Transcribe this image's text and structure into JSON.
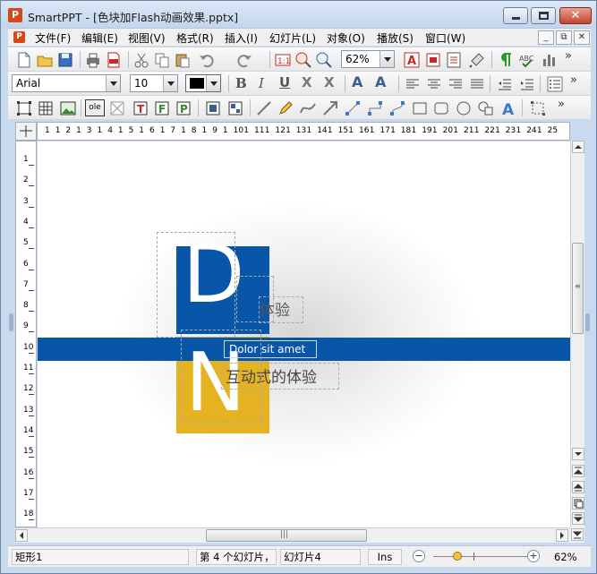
{
  "window": {
    "app_icon_letter": "P",
    "title": "SmartPPT - [色块加Flash动画效果.pptx]",
    "close_glyph": "✕"
  },
  "menu": {
    "doc_icon_letter": "P",
    "items": [
      "文件(F)",
      "编辑(E)",
      "视图(V)",
      "格式(R)",
      "插入(I)",
      "幻灯片(L)",
      "对象(O)",
      "播放(S)",
      "窗口(W)"
    ],
    "mdi_buttons": [
      "_",
      "⧉",
      "✕"
    ]
  },
  "toolbar1": {
    "zoom_value": "62%",
    "icons": [
      "new-document-icon",
      "open-folder-icon",
      "save-icon",
      "print-icon",
      "export-pdf-icon",
      "cut-icon",
      "copy-icon",
      "paste-icon",
      "undo-icon",
      "redo-icon",
      "actual-size-icon",
      "zoom-fit-icon",
      "search-icon",
      "text-color-icon",
      "insert-image-icon",
      "insert-list-icon",
      "format-painter-icon",
      "paragraph-marks-icon",
      "spell-check-icon",
      "chart-icon"
    ],
    "more": "»"
  },
  "toolbar2": {
    "font_name": "Arial",
    "font_size": "10",
    "color_swatch": "#000000",
    "bold_label": "B",
    "italic_label": "I",
    "underline_label": "U",
    "strike_label": "X",
    "clear_label": "X",
    "grow_label": "A",
    "shrink_label": "A",
    "more": "»"
  },
  "toolbar3": {
    "icons": [
      "select-frame-icon",
      "table-icon",
      "picture-icon",
      "ole-object-icon",
      "video-icon",
      "text-box-icon",
      "frame-f-icon",
      "frame-p-icon",
      "group-icon",
      "ungroup-icon",
      "line-icon",
      "pencil-icon",
      "curve-icon",
      "arrow-icon",
      "connector-icon",
      "elbow-connector-icon",
      "curved-connector-icon",
      "rectangle-icon",
      "rounded-rectangle-icon",
      "ellipse-icon",
      "shapes-icon",
      "word-art-icon",
      "align-icon"
    ],
    "ole_label": "ole",
    "more": "»"
  },
  "ruler": {
    "h_numbers": [
      "1",
      "1",
      "2",
      "1",
      "3",
      "1",
      "4",
      "1",
      "5",
      "1",
      "6",
      "1",
      "7",
      "1",
      "8",
      "1",
      "9",
      "1",
      "10",
      "1",
      "11",
      "1",
      "12",
      "1",
      "13",
      "1",
      "14",
      "1",
      "15",
      "1",
      "16",
      "1",
      "17",
      "1",
      "18",
      "1",
      "19",
      "1",
      "20",
      "1",
      "21",
      "1",
      "22",
      "1",
      "23",
      "1",
      "24",
      "1",
      "25"
    ],
    "v_numbers": [
      "1",
      "2",
      "3",
      "4",
      "5",
      "6",
      "7",
      "8",
      "9",
      "10",
      "11",
      "12",
      "13",
      "14",
      "15",
      "16",
      "17",
      "18"
    ]
  },
  "slide": {
    "letter_top": "D",
    "letter_bottom": "N",
    "band_text": "Dolor sit amet",
    "text_top": "体验",
    "text_bottom": "互动式的体验",
    "colors": {
      "blue": "#0756a8",
      "yellow": "#e5b322"
    }
  },
  "scroll": {
    "grip": "|||"
  },
  "status": {
    "object": "矩形1",
    "slide_index": "第 4 个幻灯片，",
    "slide_name": "幻灯片4",
    "mode": "Ins",
    "zoom_minus": "−",
    "zoom_plus": "+",
    "zoom": "62%"
  }
}
